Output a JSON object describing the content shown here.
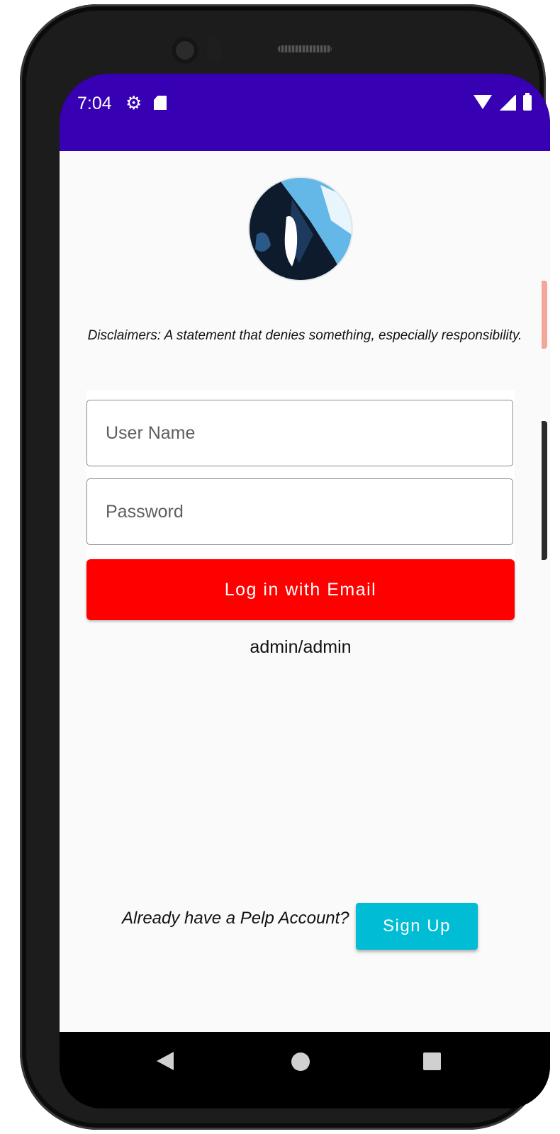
{
  "status_bar": {
    "time": "7:04",
    "icons": [
      "gear-icon",
      "sd-card-icon",
      "wifi-icon",
      "signal-icon",
      "battery-icon"
    ],
    "background": "#3700b3"
  },
  "login": {
    "disclaimer": "Disclaimers: A statement that denies something, especially responsibility.",
    "username_placeholder": "User Name",
    "password_placeholder": "Password",
    "login_button": "Log in with Email",
    "login_button_color": "#ff0000",
    "hint": "admin/admin",
    "account_prompt": "Already have a Pelp Account?",
    "signup_button": "Sign Up",
    "signup_button_color": "#00bcd4"
  },
  "nav": {
    "icons": [
      "back-icon",
      "home-icon",
      "recents-icon"
    ]
  }
}
